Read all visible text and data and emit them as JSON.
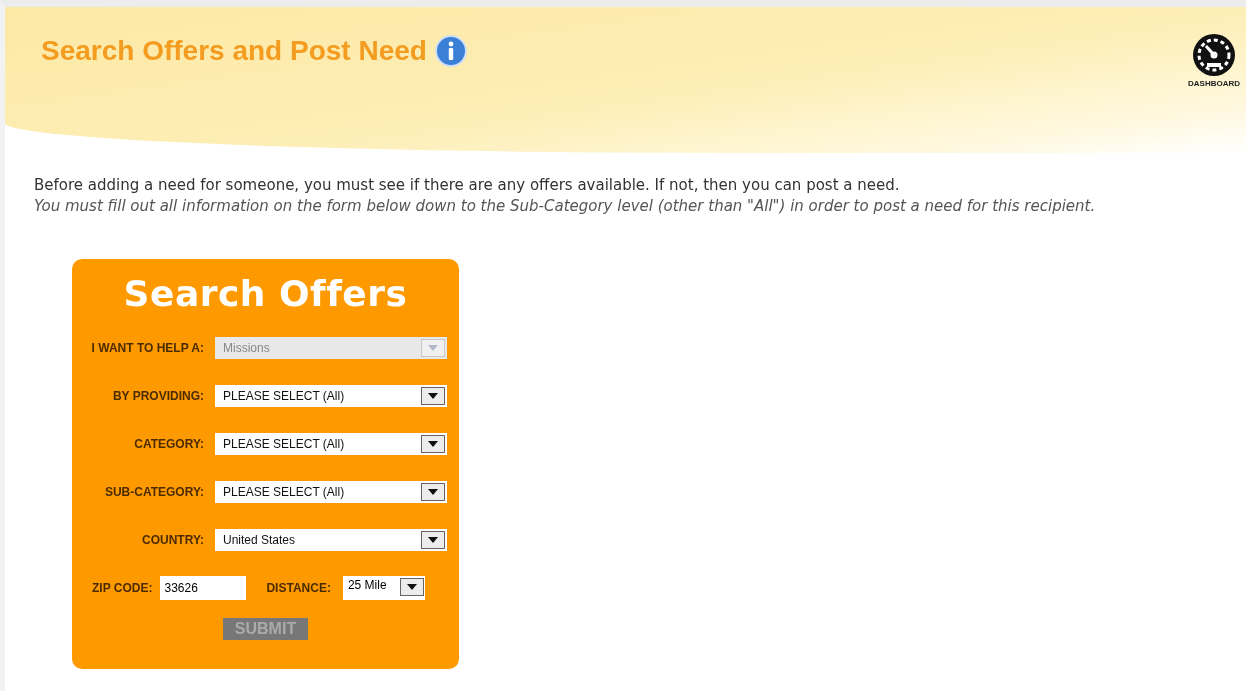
{
  "header": {
    "title": "Search Offers and Post Need",
    "dashboard_label": "DASHBOARD"
  },
  "intro": {
    "text": "Before adding a need for someone, you must see if there are any offers available. If not, then you can post a need.",
    "note": "You must fill out all information on the form below down to the Sub-Category level (other than \"All\") in order to post a need for this recipient."
  },
  "form": {
    "title": "Search Offers",
    "fields": [
      {
        "label": "I WANT TO HELP A:",
        "value": "Missions",
        "disabled": true
      },
      {
        "label": "BY PROVIDING:",
        "value": "PLEASE SELECT (All)",
        "disabled": false
      },
      {
        "label": "CATEGORY:",
        "value": "PLEASE SELECT (All)",
        "disabled": false
      },
      {
        "label": "SUB-CATEGORY:",
        "value": "PLEASE SELECT (All)",
        "disabled": false
      },
      {
        "label": "COUNTRY:",
        "value": "United States",
        "disabled": false
      }
    ],
    "zip": {
      "label": "ZIP CODE:",
      "value": "33626"
    },
    "distance": {
      "label": "DISTANCE:",
      "value": "25 Mile"
    },
    "submit": {
      "label": "SUBMIT",
      "disabled": true
    }
  }
}
